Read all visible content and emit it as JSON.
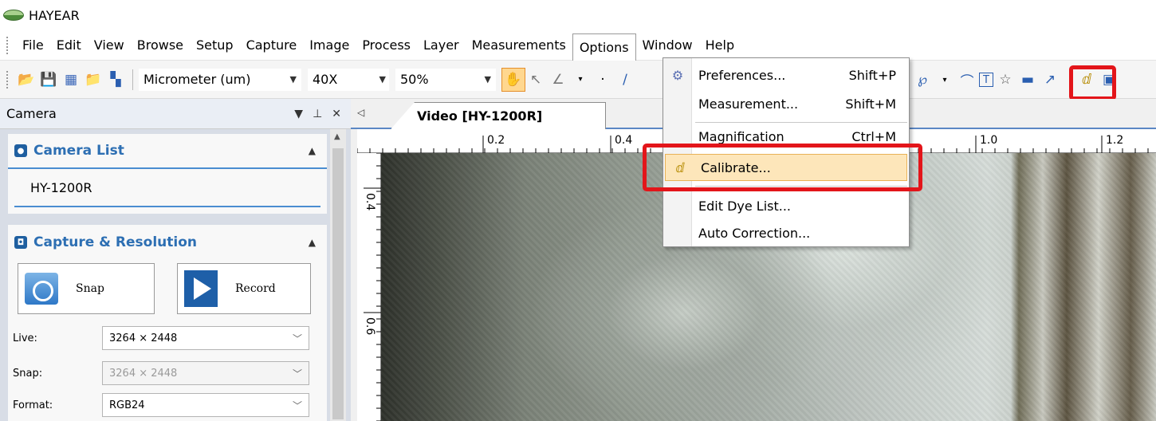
{
  "app": {
    "title": "HAYEAR"
  },
  "menu": [
    "File",
    "Edit",
    "View",
    "Browse",
    "Setup",
    "Capture",
    "Image",
    "Process",
    "Layer",
    "Measurements",
    "Options",
    "Window",
    "Help"
  ],
  "toolbar": {
    "unit": "Micrometer (um)",
    "magnification": "40X",
    "zoom": "50%"
  },
  "camera_panel": {
    "title": "Camera",
    "camera_list_header": "Camera List",
    "camera_name": "HY-1200R",
    "capture_header": "Capture & Resolution",
    "snap_label": "Snap",
    "record_label": "Record",
    "live_label": "Live:",
    "live_value": "3264 × 2448",
    "snap_res_label": "Snap:",
    "snap_res_value": "3264 × 2448",
    "format_label": "Format:",
    "format_value": "RGB24"
  },
  "document": {
    "tab_label": "Video [HY-1200R]",
    "ruler_h": [
      "0.2",
      "0.4",
      "1.0",
      "1.2"
    ],
    "ruler_v": [
      "0.4",
      "0.6"
    ]
  },
  "options_menu": {
    "items": [
      {
        "label": "Preferences...",
        "shortcut": "Shift+P"
      },
      {
        "label": "Measurement...",
        "shortcut": "Shift+M"
      },
      {
        "label": "Magnification",
        "shortcut": "Ctrl+M"
      },
      {
        "label": "Calibrate...",
        "shortcut": ""
      },
      {
        "label": "Edit Dye List...",
        "shortcut": ""
      },
      {
        "label": "Auto Correction...",
        "shortcut": ""
      }
    ]
  },
  "colors": {
    "highlight": "#e3151a",
    "accent": "#2d6fb3",
    "menu_hover": "#fde6ba"
  }
}
